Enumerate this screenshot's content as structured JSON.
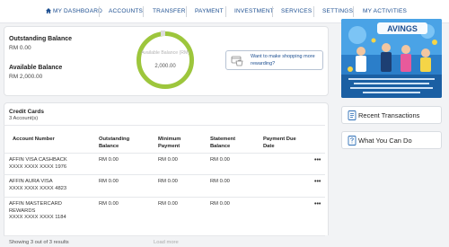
{
  "nav": {
    "items": [
      {
        "label": "MY DASHBOARD",
        "icon": "home-icon"
      },
      {
        "label": "ACCOUNTS"
      },
      {
        "label": "TRANSFER"
      },
      {
        "label": "PAYMENT"
      },
      {
        "label": "INVESTMENT"
      },
      {
        "label": "SERVICES"
      },
      {
        "label": "SETTINGS"
      },
      {
        "label": "MY ACTIVITIES"
      }
    ]
  },
  "summary": {
    "outstanding_label": "Outstanding Balance",
    "outstanding_value": "RM 0.00",
    "available_label": "Available Balance",
    "available_value": "RM 2,000.00",
    "ring_label": "Available Balance (RM)",
    "ring_value": "2,000.00",
    "promo_text_line1": "Want to make shopping more",
    "promo_text_line2": "rewarding?"
  },
  "credit_cards": {
    "title": "Credit Cards",
    "count": "3 Account(s)",
    "headers": {
      "account": "Account Number",
      "outstanding_1": "Outstanding",
      "outstanding_2": "Balance",
      "minimum_1": "Minimum",
      "minimum_2": "Payment",
      "statement_1": "Statement",
      "statement_2": "Balance",
      "due_1": "Payment Due",
      "due_2": "Date"
    },
    "rows": [
      {
        "name": "AFFIN VISA CASHBACK",
        "number": "XXXX XXXX XXXX 1976",
        "outstanding": "RM 0.00",
        "minimum": "RM 0.00",
        "statement": "RM 0.00",
        "due": "",
        "menu": "•••"
      },
      {
        "name": "AFFIN AURA VISA",
        "number": "XXXX XXXX XXXX 4823",
        "outstanding": "RM 0.00",
        "minimum": "RM 0.00",
        "statement": "RM 0.00",
        "due": "",
        "menu": "•••"
      },
      {
        "name_1": "AFFIN MASTERCARD",
        "name_2": "REWARDS",
        "number": "XXXX XXXX XXXX 1184",
        "outstanding": "RM 0.00",
        "minimum": "RM 0.00",
        "statement": "RM 0.00",
        "due": "",
        "menu": "•••"
      }
    ],
    "showing": "Showing 3 out of 3 results",
    "load_more": "Load more"
  },
  "sidebar": {
    "banner_title": "AVINGS",
    "recent_transactions": "Recent Transactions",
    "what_you_can_do": "What You Can Do"
  },
  "colors": {
    "nav_text": "#1d4f91",
    "ring": "#9dc63c",
    "banner_bg": "#2b7ec9"
  }
}
